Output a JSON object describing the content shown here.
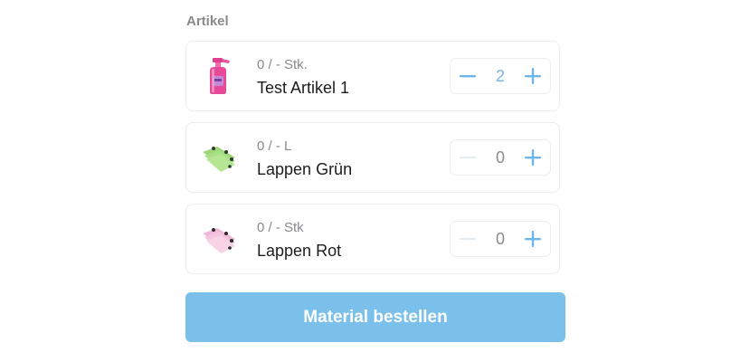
{
  "section": {
    "title": "Artikel"
  },
  "colors": {
    "accent": "#6eb6ea",
    "accent_disabled": "#d8e8f5",
    "order_button": "#7ac0eb",
    "secondary_text": "#8a8a8e",
    "border": "#ececef"
  },
  "items": [
    {
      "unit_info": "0 / - Stk.",
      "name": "Test Artikel 1",
      "quantity": "2",
      "image_icon": "spray-bottle-icon",
      "minus_enabled": true
    },
    {
      "unit_info": "0 / - L",
      "name": "Lappen Grün",
      "quantity": "0",
      "image_icon": "green-cloth-icon",
      "minus_enabled": false
    },
    {
      "unit_info": "0 / - Stk",
      "name": "Lappen Rot",
      "quantity": "0",
      "image_icon": "pink-cloth-icon",
      "minus_enabled": false
    }
  ],
  "order_button": {
    "label": "Material bestellen"
  }
}
